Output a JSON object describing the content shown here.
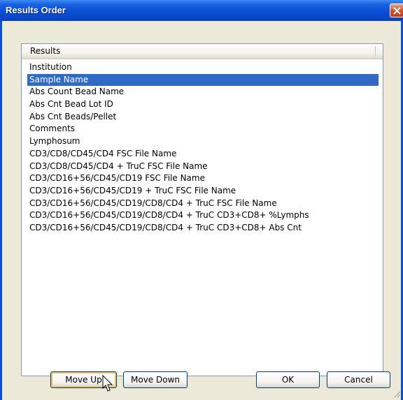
{
  "window": {
    "title": "Results Order"
  },
  "list": {
    "header": "Results",
    "selected_index": 1,
    "items": [
      "Institution",
      "Sample Name",
      "Abs Count Bead Name",
      "Abs Cnt Bead Lot ID",
      "Abs Cnt Beads/Pellet",
      "Comments",
      "Lymphosum",
      "CD3/CD8/CD45/CD4 FSC File Name",
      "CD3/CD8/CD45/CD4 + TruC FSC File Name",
      "CD3/CD16+56/CD45/CD19 FSC File Name",
      "CD3/CD16+56/CD45/CD19 + TruC FSC File Name",
      "CD3/CD16+56/CD45/CD19/CD8/CD4 + TruC FSC File Name",
      "CD3/CD16+56/CD45/CD19/CD8/CD4 + TruC CD3+CD8+ %Lymphs",
      "CD3/CD16+56/CD45/CD19/CD8/CD4 + TruC CD3+CD8+ Abs Cnt"
    ]
  },
  "buttons": {
    "move_up": "Move Up",
    "move_down": "Move Down",
    "ok": "OK",
    "cancel": "Cancel"
  },
  "colors": {
    "selection": "#316AC5",
    "titlebar": "#0B4FD6",
    "dialog_bg": "#ECE9D8"
  },
  "icons": {
    "close": "close-icon",
    "cursor": "mouse-pointer-icon",
    "grip": "resize-grip-icon"
  }
}
